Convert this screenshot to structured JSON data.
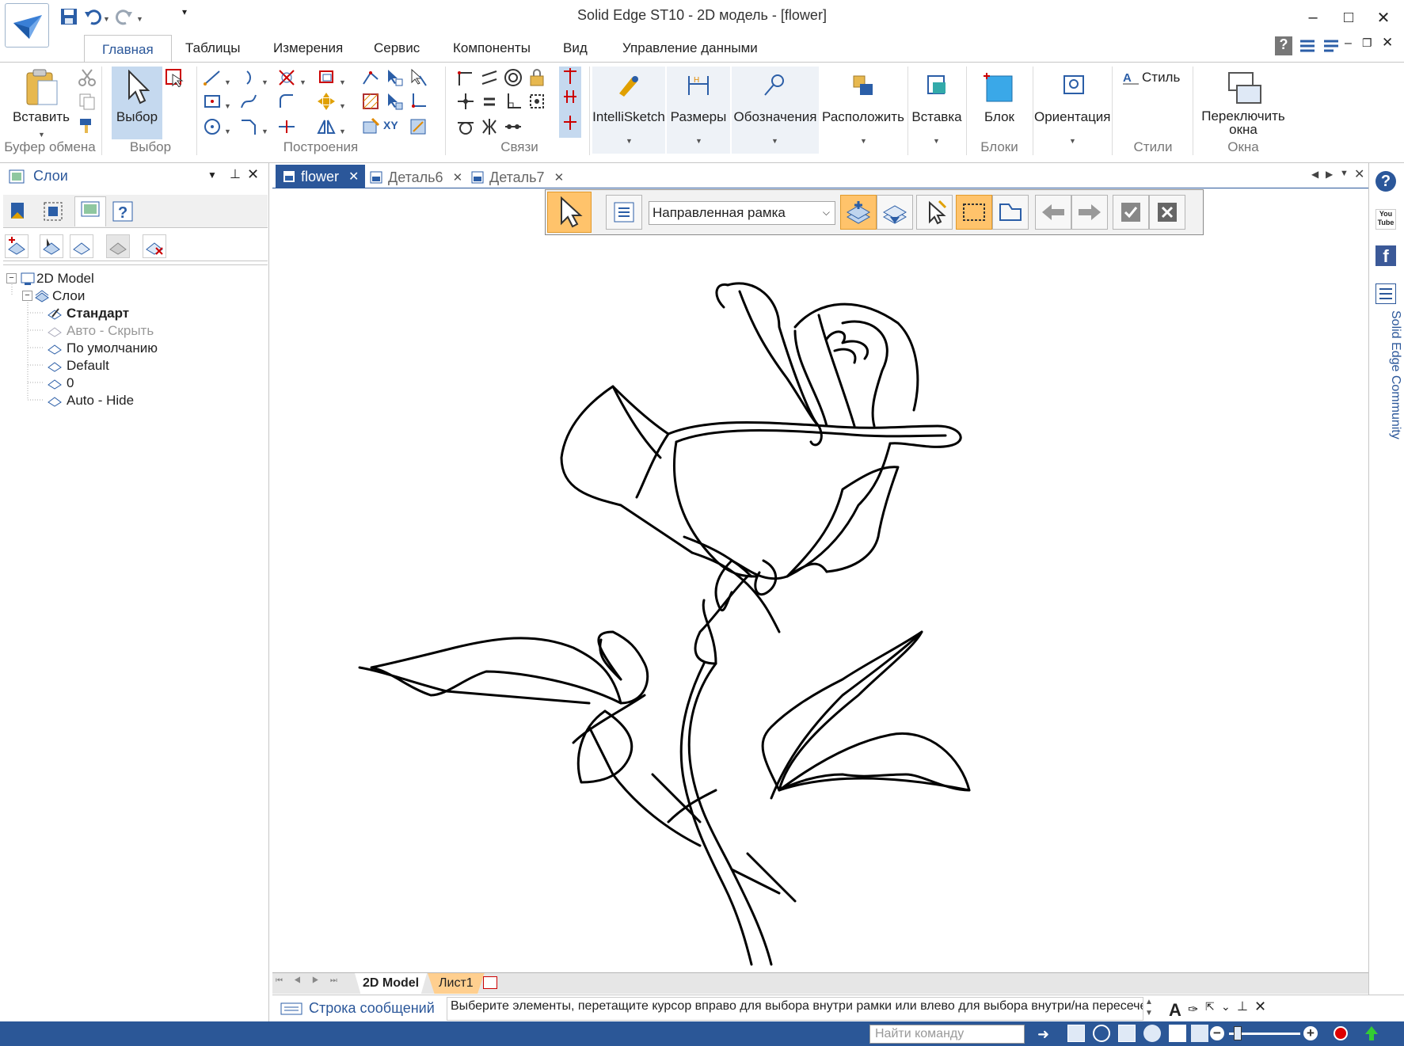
{
  "window": {
    "title": "Solid Edge ST10 - 2D модель - [flower]",
    "minimize": "–",
    "maximize": "□",
    "close": "✕"
  },
  "ribbon_tabs": [
    {
      "label": "Главная",
      "active": true
    },
    {
      "label": "Таблицы"
    },
    {
      "label": "Измерения"
    },
    {
      "label": "Сервис"
    },
    {
      "label": "Компоненты"
    },
    {
      "label": "Вид"
    },
    {
      "label": "Управление данными"
    }
  ],
  "ribbon": {
    "paste_label": "Вставить",
    "select_label": "Выбор",
    "intellisketch_label": "IntelliSketch",
    "dimensions_label": "Размеры",
    "annotations_label": "Обозначения",
    "arrange_label": "Расположить",
    "insert_label": "Вставка",
    "block_label": "Блок",
    "orientation_label": "Ориентация",
    "style_label": "Стиль",
    "switch_windows_label": "Переключить окна",
    "xy_label": "XY",
    "groups": {
      "clipboard": "Буфер обмена",
      "select": "Выбор",
      "draw": "Построения",
      "relate": "Связи",
      "blocks": "Блоки",
      "styles": "Стили",
      "windows": "Окна"
    }
  },
  "layers_panel": {
    "title": "Слои",
    "tree": {
      "root": "2D Model",
      "folder": "Слои",
      "items": [
        {
          "label": "Стандарт",
          "bold": true
        },
        {
          "label": "Авто - Скрыть",
          "dim": true
        },
        {
          "label": "По умолчанию"
        },
        {
          "label": "Default"
        },
        {
          "label": "0"
        },
        {
          "label": "Auto - Hide"
        }
      ]
    }
  },
  "doc_tabs": [
    {
      "label": "flower",
      "active": true
    },
    {
      "label": "Деталь6"
    },
    {
      "label": "Деталь7"
    }
  ],
  "command_bar": {
    "select_mode": "Направленная рамка"
  },
  "sheet_tabs": [
    {
      "label": "2D Model",
      "active": true
    },
    {
      "label": "Лист1"
    }
  ],
  "message_bar": {
    "title": "Строка сообщений",
    "text": "Выберите элементы, перетащите курсор вправо для выбора внутри рамки или влево для выбора внутри/на пересечении с рамкой, или"
  },
  "status_bar": {
    "find_command_placeholder": "Найти команду"
  },
  "right_strip": {
    "community_label": "Solid Edge Community",
    "youtube_label": "You Tube"
  },
  "colors": {
    "accent_blue": "#2b579a",
    "status_bar": "#2b5797",
    "highlight_orange": "#ffc36b",
    "select_active": "#c5d9ef"
  }
}
